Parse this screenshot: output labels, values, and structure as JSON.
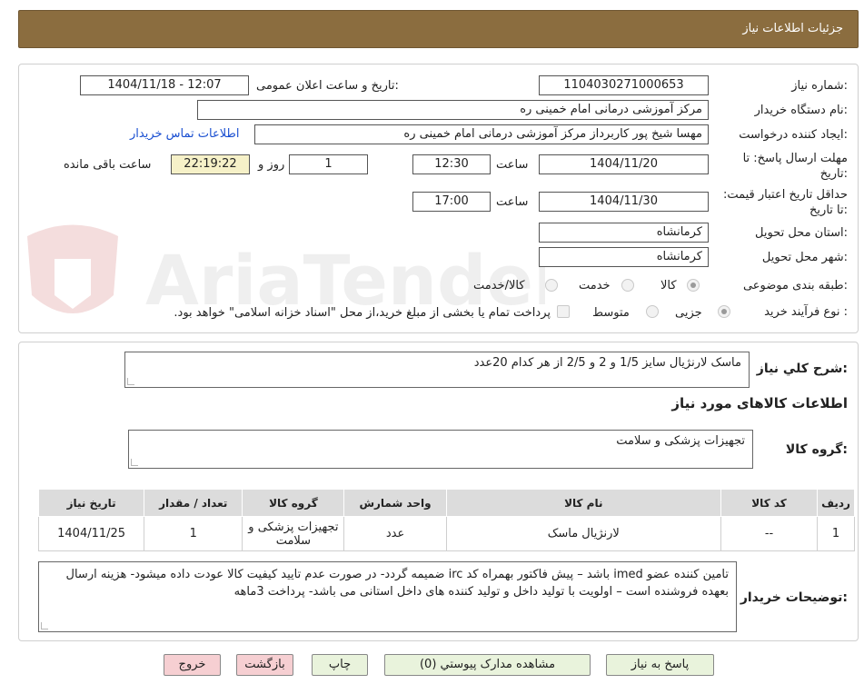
{
  "header": {
    "title": "جزئیات اطلاعات نیاز"
  },
  "watermark": {
    "text": "AriaTender.neT"
  },
  "form": {
    "need_number_label": "شماره نیاز:",
    "need_number": "1104030271000653",
    "announce_label": "تاریخ و ساعت اعلان عمومی:",
    "announce_value": "1404/11/18 - 12:07",
    "buyer_org_label": "نام دستگاه خریدار:",
    "buyer_org": "مرکز آموزشی درمانی امام خمینی ره",
    "creator_label": "ایجاد کننده درخواست:",
    "creator": "مهسا شیخ پور کاربرداز مرکز آموزشی درمانی امام خمینی ره",
    "contact_link": "اطلاعات تماس خریدار",
    "deadline_label": "مهلت ارسال پاسخ: تا تاریخ:",
    "deadline_date": "1404/11/20",
    "time_label": "ساعت",
    "deadline_time": "12:30",
    "days_value": "1",
    "days_label": "روز و",
    "remaining_time": "22:19:22",
    "remaining_label": "ساعت باقی مانده",
    "validity_label": "حداقل تاریخ اعتبار قیمت: تا تاریخ:",
    "validity_date": "1404/11/30",
    "validity_time": "17:00",
    "province_label": "استان محل تحویل:",
    "province": "کرمانشاه",
    "city_label": "شهر محل تحویل:",
    "city": "کرمانشاه",
    "category_label": "طبقه بندی موضوعی:",
    "category_options": [
      "کالا",
      "خدمت",
      "کالا/خدمت"
    ],
    "process_label": "نوع فرآیند خرید :",
    "process_options": [
      "جزیی",
      "متوسط"
    ],
    "payment_note": "پرداخت تمام یا بخشی از مبلغ خرید،از محل \"اسناد خزانه اسلامی\" خواهد بود."
  },
  "details": {
    "summary_label": "شرح کلي نياز:",
    "summary": "ماسک لارنژیال سایز 1/5 و 2 و 2/5 از هر کدام 20عدد",
    "goods_info_title": "اطلاعات کالاهای مورد نیاز",
    "group_label": "گروه کالا:",
    "group_value": "تجهیزات پزشکی و سلامت",
    "table": {
      "headers": [
        "ردیف",
        "کد کالا",
        "نام کالا",
        "واحد شمارش",
        "گروه کالا",
        "تعداد / مقدار",
        "تاریخ نیاز"
      ],
      "rows": [
        [
          "1",
          "--",
          "لارنژیال ماسک",
          "عدد",
          "تجهیزات پزشکی و سلامت",
          "1",
          "1404/11/25"
        ]
      ]
    },
    "buyer_notes_label": "توضیحات خریدار:",
    "buyer_notes": "تامین کننده عضو imed باشد – پیش فاکتور بهمراه کد irc ضمیمه گردد- در صورت عدم تایید کیفیت کالا عودت داده میشود- هزینه ارسال بعهده فروشنده است – اولویت با تولید داخل و تولید کننده های داخل استانی می باشد- پرداخت 3ماهه"
  },
  "buttons": {
    "reply": "پاسخ به نیاز",
    "attachments": "مشاهده مدارک پیوستي (0)",
    "print": "چاپ",
    "back": "بازگشت",
    "exit": "خروج"
  }
}
